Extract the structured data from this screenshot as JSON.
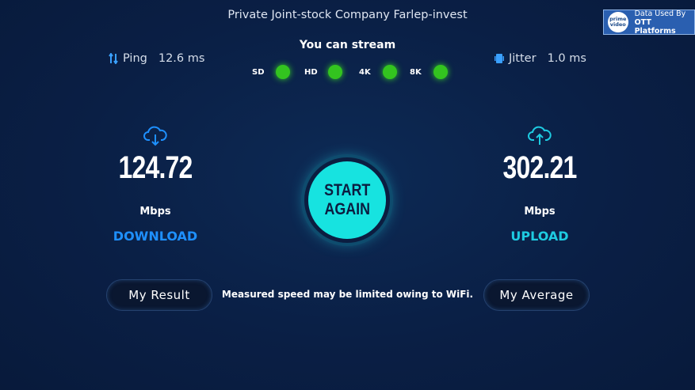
{
  "header": {
    "isp": "Private Joint-stock Company Farlep-invest"
  },
  "badge": {
    "logo_line1": "prime",
    "logo_line2": "video",
    "line1": "Data Used By",
    "line2": "OTT Platforms"
  },
  "ping": {
    "label": "Ping",
    "value": "12.6 ms"
  },
  "jitter": {
    "label": "Jitter",
    "value": "1.0 ms"
  },
  "stream": {
    "title": "You can stream",
    "qualities": [
      {
        "label": "SD"
      },
      {
        "label": "HD"
      },
      {
        "label": "4K"
      },
      {
        "label": "8K"
      }
    ]
  },
  "download": {
    "value": "124.72",
    "unit": "Mbps",
    "label": "DOWNLOAD"
  },
  "upload": {
    "value": "302.21",
    "unit": "Mbps",
    "label": "UPLOAD"
  },
  "start": {
    "line1": "START",
    "line2": "AGAIN"
  },
  "buttons": {
    "result": "My Result",
    "average": "My Average"
  },
  "note": "Measured speed may be limited owing to WiFi.",
  "colors": {
    "download": "#1e90ff",
    "upload": "#1ecbe1",
    "start": "#17e3e0",
    "dot": "#33c41f"
  },
  "icons": {
    "ping": "updown-arrows-icon",
    "jitter": "phone-icon",
    "download": "cloud-download-icon",
    "upload": "cloud-upload-icon"
  }
}
